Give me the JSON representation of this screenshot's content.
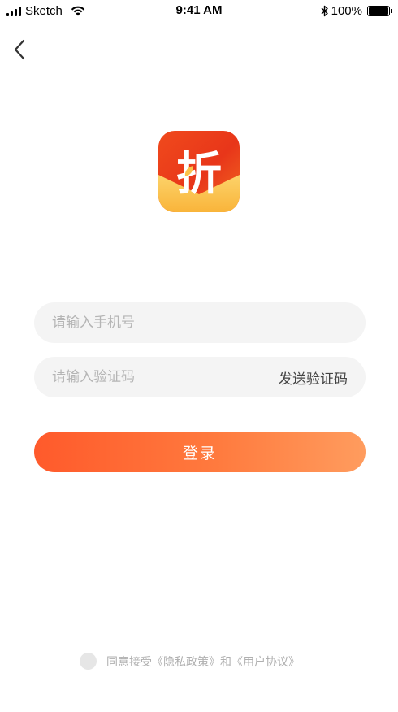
{
  "status_bar": {
    "carrier": "Sketch",
    "time": "9:41 AM",
    "battery": "100%"
  },
  "logo": {
    "glyph": "折"
  },
  "form": {
    "phone_placeholder": "请输入手机号",
    "code_placeholder": "请输入验证码",
    "send_code_label": "发送验证码",
    "login_label": "登录"
  },
  "agreement": {
    "prefix": "同意接受",
    "privacy_link": "《隐私政策》",
    "conjunction": "和",
    "terms_link": "《用户协议》"
  },
  "colors": {
    "accent_start": "#ff5a2b",
    "accent_end": "#ff9c5e",
    "logo_red": "#e8361a",
    "logo_gold": "#fbc24a"
  }
}
